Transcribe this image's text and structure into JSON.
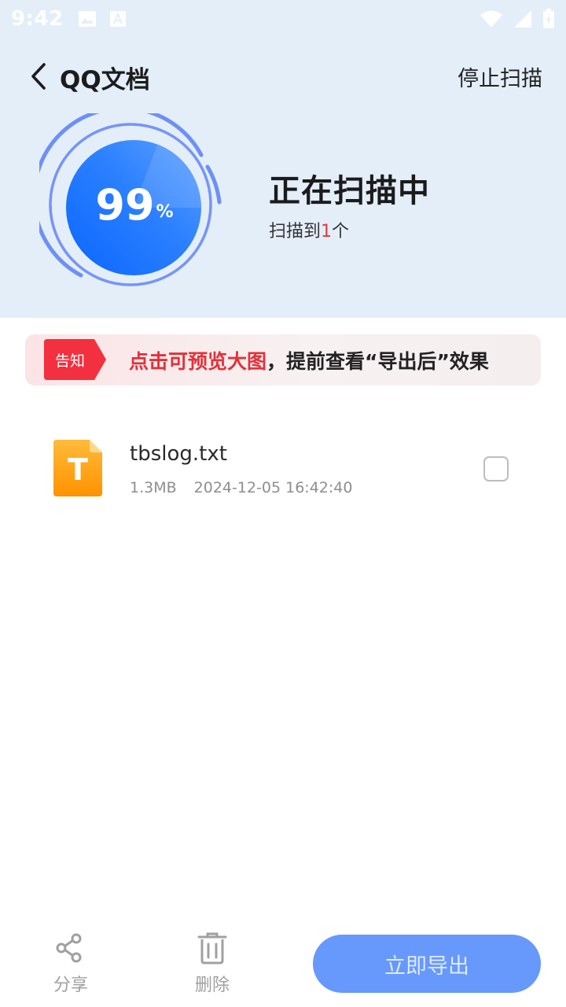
{
  "status_bar": {
    "time": "9:42",
    "icons": [
      "image-icon",
      "a-icon",
      "wifi-icon",
      "signal-icon",
      "battery-icon"
    ]
  },
  "nav": {
    "title": "QQ文档",
    "stop_label": "停止扫描"
  },
  "progress": {
    "percent": "99",
    "unit": "%"
  },
  "scan": {
    "title": "正在扫描中",
    "sub_prefix": "扫描到",
    "count": "1",
    "sub_suffix": "个"
  },
  "notice": {
    "tag": "告知",
    "text_red": "点击可预览大图",
    "text_rest": "，提前查看“导出后”效果"
  },
  "files": [
    {
      "icon_letter": "T",
      "name": "tbslog.txt",
      "size": "1.3MB",
      "date": "2024-12-05 16:42:40"
    }
  ],
  "bottom": {
    "share_label": "分享",
    "delete_label": "删除",
    "export_label": "立即导出"
  },
  "colors": {
    "header_bg": "#e3eef9",
    "ring_blue": "#1a73ff",
    "accent_red": "#e4303a",
    "export_btn": "#6699fb",
    "file_icon_orange": "#ff9f16"
  }
}
